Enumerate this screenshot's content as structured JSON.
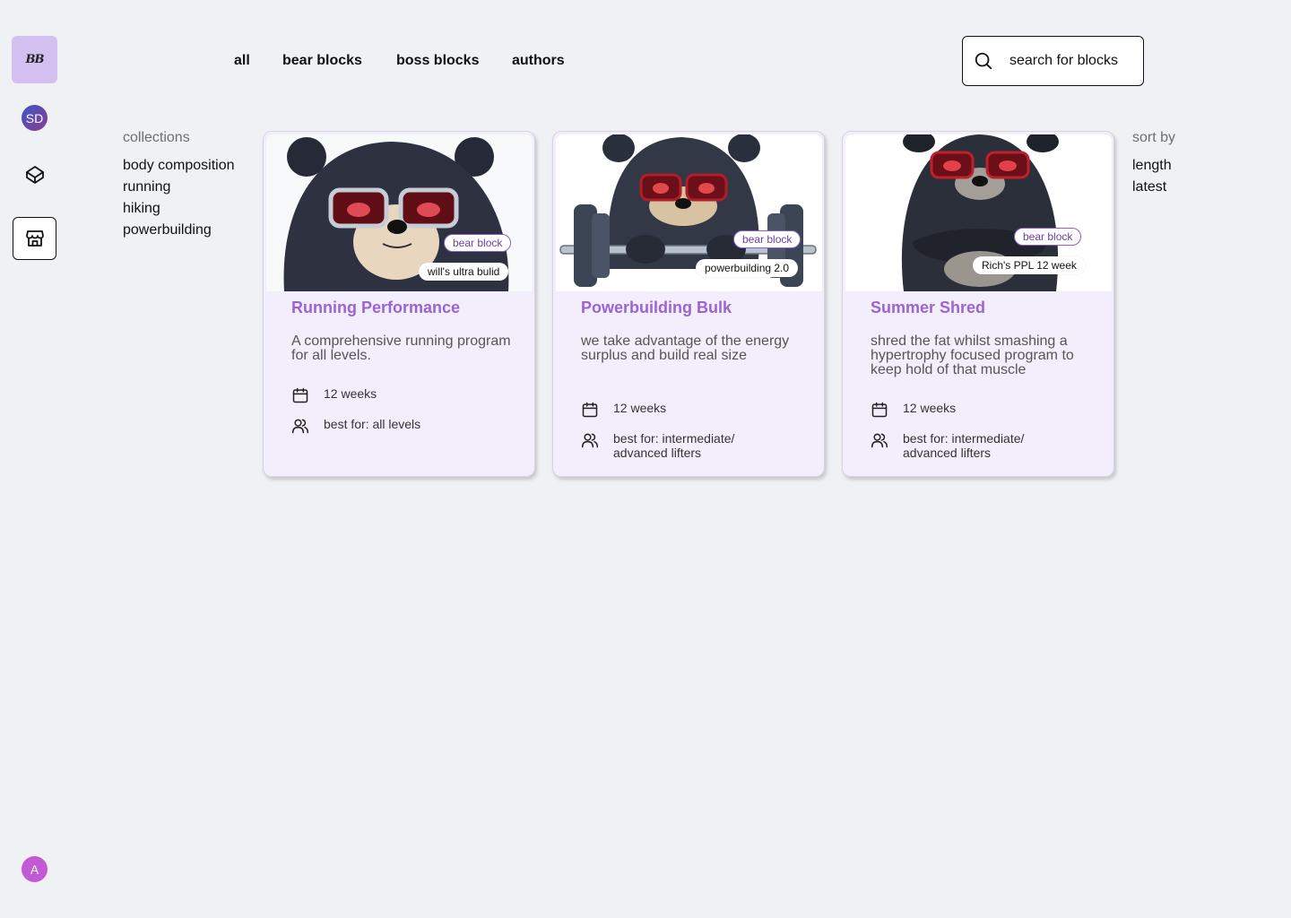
{
  "sidebar": {
    "logo_text": "BB",
    "profile_initials": "SD",
    "user_initial": "A"
  },
  "nav": {
    "all": "all",
    "bear_blocks": "bear blocks",
    "boss_blocks": "boss blocks",
    "authors": "authors"
  },
  "search": {
    "placeholder": "search for blocks"
  },
  "collections": {
    "heading": "collections",
    "items": [
      "body composition",
      "running",
      "hiking",
      "powerbuilding"
    ]
  },
  "sort": {
    "heading": "sort by",
    "items": [
      "length",
      "latest"
    ]
  },
  "cards": [
    {
      "title": "Running Performance",
      "description": "A comprehensive running program for all levels.",
      "type_badge": "bear block",
      "author_badge": "will's ultra bulid",
      "duration": "12 weeks",
      "best_for": "best for: all levels"
    },
    {
      "title": "Powerbuilding Bulk",
      "description": "we take advantage of the energy surplus and build real size",
      "type_badge": "bear block",
      "author_badge": "powerbuilding 2.0",
      "duration": "12 weeks",
      "best_for": "best for: intermediate/ advanced lifters"
    },
    {
      "title": "Summer Shred",
      "description": "shred the fat whilst smashing a hypertrophy focused program to keep hold of that muscle",
      "type_badge": "bear block",
      "author_badge": "Rich's PPL 12 week",
      "duration": "12 weeks",
      "best_for": "best for: intermediate/ advanced lifters"
    }
  ],
  "colors": {
    "accent": "#9b63d3",
    "logo_bg": "#d4bff1",
    "card_bg": "#f3eefb",
    "page_bg": "#f0f1f4"
  }
}
